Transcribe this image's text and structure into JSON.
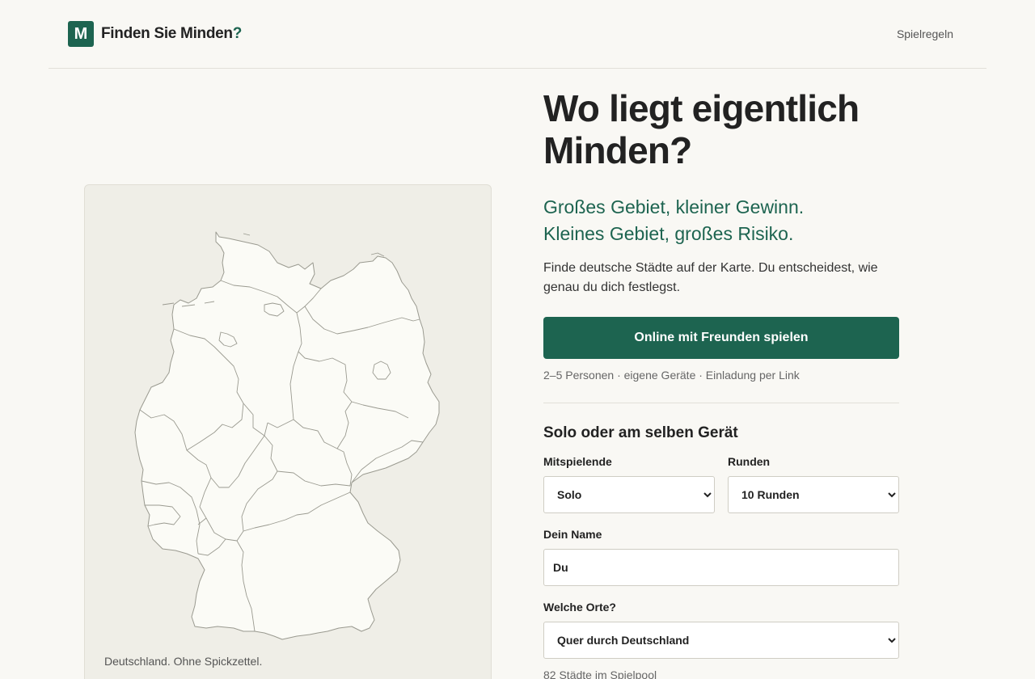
{
  "header": {
    "logo_letter": "M",
    "title": "Finden Sie Minden",
    "title_suffix": "?",
    "nav_rules": "Spielregeln"
  },
  "map": {
    "caption": "Deutschland. Ohne Spickzettel.",
    "colors": {
      "fill": "#fbfbf6",
      "stroke": "#9a9a90",
      "background": "#efeee7"
    }
  },
  "hero": {
    "title": "Wo liegt eigentlich Minden?",
    "tagline_1": "Großes Gebiet, kleiner Gewinn.",
    "tagline_2": "Kleines Gebiet, großes Risiko.",
    "intro": "Finde deutsche Städte auf der Karte. Du entscheidest, wie genau du dich festlegst.",
    "online_button": "Online mit Freunden spielen",
    "online_hint": "2–5 Personen · eigene Geräte · Einladung per Link"
  },
  "solo": {
    "heading": "Solo oder am selben Gerät",
    "players_label": "Mitspielende",
    "players_value": "Solo",
    "rounds_label": "Runden",
    "rounds_value": "10 Runden",
    "name_label": "Dein Name",
    "name_value": "Du",
    "places_label": "Welche Orte?",
    "places_value": "Quer durch Deutschland",
    "pool_note": "82 Städte im Spielpool"
  },
  "colors": {
    "accent": "#1d6450",
    "background": "#f9f8f4"
  }
}
